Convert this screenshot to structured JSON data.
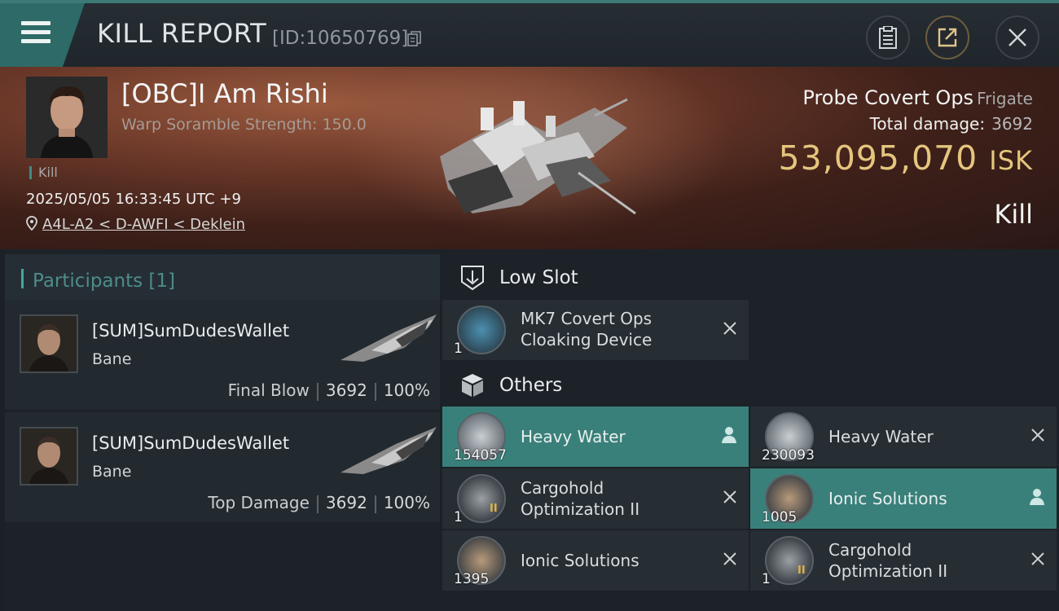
{
  "header": {
    "title": "KILL REPORT",
    "report_id": "[ID:10650769]",
    "menu_icon": "hamburger-icon",
    "buttons": [
      "clipboard-icon",
      "share-icon",
      "close-icon"
    ]
  },
  "victim": {
    "name": "[OBC]I Am Rishi",
    "warp_scramble": "Warp Soramble Strength: 150.0",
    "kill_tag": "Kill",
    "datetime": "2025/05/05 16:33:45 UTC +9",
    "location": "A4L-A2 < D-AWFI < Deklein",
    "ship_name": "Probe Covert Ops",
    "ship_class": "Frigate",
    "total_damage_label": "Total damage:",
    "total_damage_value": "3692",
    "isk_value": "53,095,070",
    "isk_unit": "ISK",
    "result": "Kill"
  },
  "participants": {
    "title": "Participants [1]",
    "rows": [
      {
        "name": "[SUM]SumDudesWallet",
        "ship": "Bane",
        "label": "Final Blow",
        "damage": "3692",
        "percent": "100%"
      },
      {
        "name": "[SUM]SumDudesWallet",
        "ship": "Bane",
        "label": "Top Damage",
        "damage": "3692",
        "percent": "100%"
      }
    ]
  },
  "fitting": {
    "low_slot": {
      "title": "Low Slot",
      "items": [
        {
          "qty": "1",
          "name_line1": "MK7 Covert Ops",
          "name_line2": "Cloaking Device"
        }
      ]
    },
    "others": {
      "title": "Others",
      "items": [
        {
          "qty": "154057",
          "name_line1": "Heavy Water",
          "name_line2": "",
          "dropped": true
        },
        {
          "qty": "230093",
          "name_line1": "Heavy Water",
          "name_line2": "",
          "dropped": false
        },
        {
          "qty": "1",
          "name_line1": "Cargohold",
          "name_line2": "Optimization II",
          "dropped": false,
          "tier": "II"
        },
        {
          "qty": "1005",
          "name_line1": "Ionic Solutions",
          "name_line2": "",
          "dropped": true
        },
        {
          "qty": "1395",
          "name_line1": "Ionic Solutions",
          "name_line2": "",
          "dropped": false
        },
        {
          "qty": "1",
          "name_line1": "Cargohold",
          "name_line2": "Optimization II",
          "dropped": false,
          "tier": "II"
        }
      ]
    }
  },
  "colors": {
    "accent": "#3a807a",
    "isk": "#e5c57d",
    "participant_title": "#4d8c89"
  }
}
